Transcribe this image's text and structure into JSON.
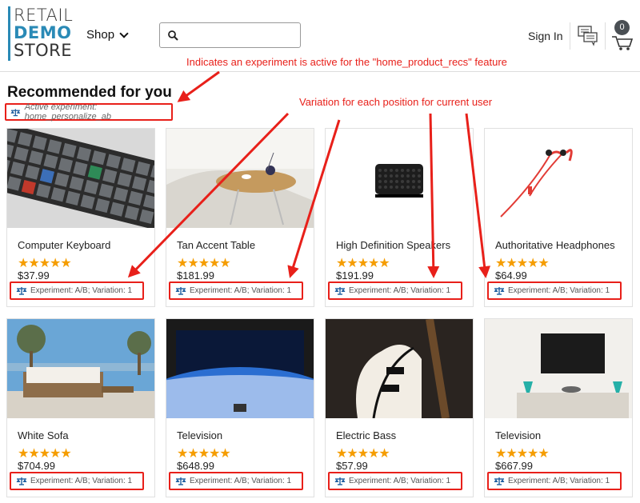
{
  "header": {
    "logo": [
      "RETAIL",
      "DEMO",
      "STORE"
    ],
    "shop_label": "Shop",
    "search_value": "",
    "signin_label": "Sign In",
    "cart_count": "0"
  },
  "section": {
    "title": "Recommended for you",
    "active_experiment": "Active experiment: home_personalize_ab"
  },
  "products": [
    {
      "name": "Computer Keyboard",
      "rating": 5,
      "stars": "★★★★★",
      "price": "$37.99",
      "experiment": "Experiment: A/B; Variation: 1",
      "image": "keyboard"
    },
    {
      "name": "Tan Accent Table",
      "rating": 5,
      "stars": "★★★★★",
      "price": "$181.99",
      "experiment": "Experiment: A/B; Variation: 1",
      "image": "table"
    },
    {
      "name": "High Definition Speakers",
      "rating": 5,
      "stars": "★★★★★",
      "price": "$191.99",
      "experiment": "Experiment: A/B; Variation: 1",
      "image": "speaker"
    },
    {
      "name": "Authoritative Headphones",
      "rating": 5,
      "stars": "★★★★★",
      "price": "$64.99",
      "experiment": "Experiment: A/B; Variation: 1",
      "image": "headphones"
    },
    {
      "name": "White Sofa",
      "rating": 5,
      "stars": "★★★★★",
      "price": "$704.99",
      "experiment": "Experiment: A/B; Variation: 1",
      "image": "sofa"
    },
    {
      "name": "Television",
      "rating": 5,
      "stars": "★★★★★",
      "price": "$648.99",
      "experiment": "Experiment: A/B; Variation: 1",
      "image": "tv-earth"
    },
    {
      "name": "Electric Bass",
      "rating": 5,
      "stars": "★★★★★",
      "price": "$57.99",
      "experiment": "Experiment: A/B; Variation: 1",
      "image": "bass"
    },
    {
      "name": "Television",
      "rating": 5,
      "stars": "★★★★★",
      "price": "$667.99",
      "experiment": "Experiment: A/B; Variation: 1",
      "image": "tv-wall"
    }
  ],
  "annotations": {
    "top": "Indicates an experiment is active for the \"home_product_recs\" feature",
    "variation": "Variation for each position for current user"
  },
  "colors": {
    "accent": "#2a8ab6",
    "highlight": "#e8201a",
    "stars": "#f59d00"
  },
  "icons": [
    "search-icon",
    "chat-icon",
    "cart-icon",
    "scale-icon",
    "chevron-down-icon"
  ]
}
